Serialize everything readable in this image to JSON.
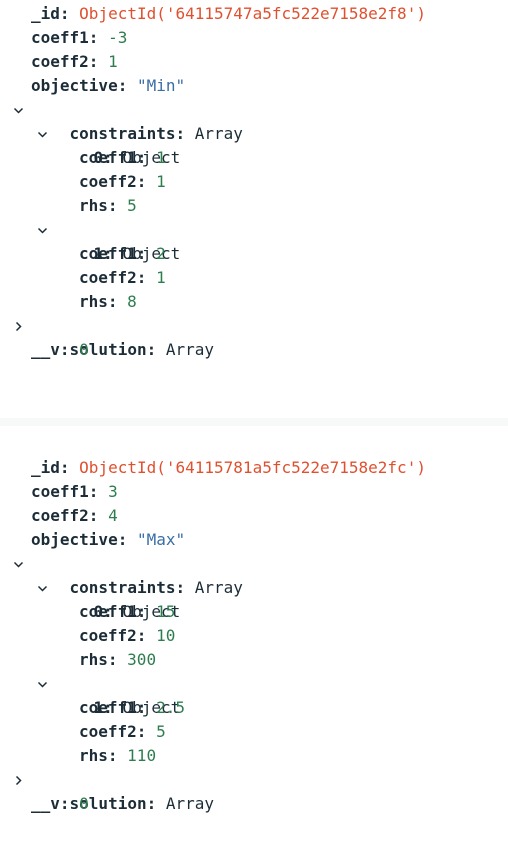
{
  "documents": [
    {
      "id_key": "_id:",
      "id_value": "ObjectId('64115747a5fc522e7158e2f8')",
      "coeff1_key": "coeff1:",
      "coeff1_value": "-3",
      "coeff2_key": "coeff2:",
      "coeff2_value": "1",
      "objective_key": "objective:",
      "objective_value": "\"Min\"",
      "constraints_key": "constraints:",
      "constraints_type": "Array",
      "constraints": [
        {
          "index_key": "0:",
          "type": "Object",
          "coeff1_key": "coeff1:",
          "coeff1_value": "1",
          "coeff2_key": "coeff2:",
          "coeff2_value": "1",
          "rhs_key": "rhs:",
          "rhs_value": "5"
        },
        {
          "index_key": "1:",
          "type": "Object",
          "coeff1_key": "coeff1:",
          "coeff1_value": "2",
          "coeff2_key": "coeff2:",
          "coeff2_value": "1",
          "rhs_key": "rhs:",
          "rhs_value": "8"
        }
      ],
      "solution_key": "solution:",
      "solution_type": "Array",
      "v_key": "__v:",
      "v_value": "0"
    },
    {
      "id_key": "_id:",
      "id_value": "ObjectId('64115781a5fc522e7158e2fc')",
      "coeff1_key": "coeff1:",
      "coeff1_value": "3",
      "coeff2_key": "coeff2:",
      "coeff2_value": "4",
      "objective_key": "objective:",
      "objective_value": "\"Max\"",
      "constraints_key": "constraints:",
      "constraints_type": "Array",
      "constraints": [
        {
          "index_key": "0:",
          "type": "Object",
          "coeff1_key": "coeff1:",
          "coeff1_value": "15",
          "coeff2_key": "coeff2:",
          "coeff2_value": "10",
          "rhs_key": "rhs:",
          "rhs_value": "300"
        },
        {
          "index_key": "1:",
          "type": "Object",
          "coeff1_key": "coeff1:",
          "coeff1_value": "2.5",
          "coeff2_key": "coeff2:",
          "coeff2_value": "5",
          "rhs_key": "rhs:",
          "rhs_value": "110"
        }
      ],
      "solution_key": "solution:",
      "solution_type": "Array",
      "v_key": "__v:",
      "v_value": "0"
    }
  ],
  "icons": {
    "expanded": "chevron-down-icon",
    "collapsed": "chevron-right-icon"
  },
  "colors": {
    "object_id": "#e0502f",
    "number": "#2e7d4f",
    "string": "#3a6ea5",
    "key": "#1c2d38"
  }
}
